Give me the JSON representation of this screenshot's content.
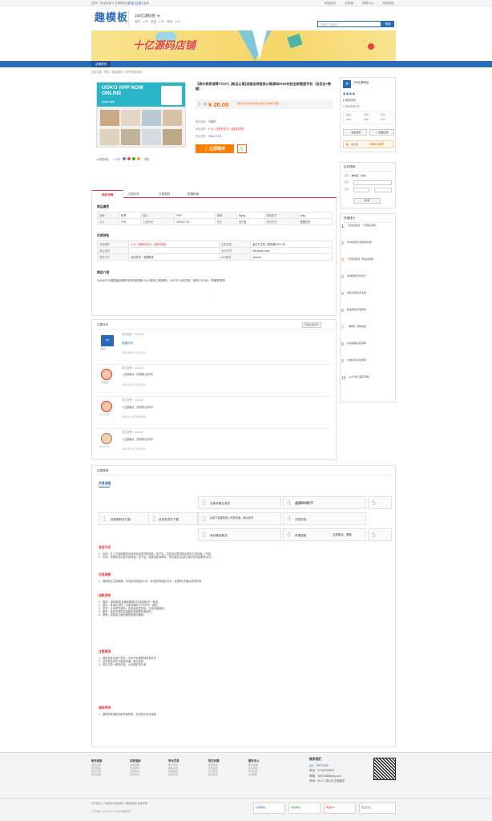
{
  "topbar": {
    "left": [
      "您好！欢迎来到十亿源码网",
      "[登录]",
      "[注册]",
      "免费"
    ],
    "right": [
      "网站首页",
      "手机版",
      "帮助中心",
      "网站导航"
    ]
  },
  "header": {
    "logo": "趣模板",
    "shop_name": "100亿源码店",
    "shop_stats": "描述：4.99　质量：4.99　服务：5.00",
    "search_placeholder": "请输入关键词",
    "search_button": "搜索"
  },
  "banner": {
    "title": "十亿源码店铺"
  },
  "nav": {
    "items": [
      "店铺首页"
    ]
  },
  "breadcrumb": "当前位置：首页 > 网站源码 > 房产/新闻/商务",
  "product": {
    "image_title": "UOKO APP NOW ONLINE",
    "image_sub": "UOKO APP",
    "title": "【高价卖家保障YOU+】[新品公寓]深度去除租房公寓源码dede内核全新整版手机（含后台+数据）",
    "price_label": "价　格",
    "price": "¥ 20.00",
    "price_note": "需支付对应价格源码 前往平台购买页面",
    "fields": [
      {
        "label": "服务保障",
        "value": "不退货"
      },
      {
        "label": "卖家保障",
        "value": "¥ 15（可额外支付）【保障说明】"
      },
      {
        "label": "最后更新",
        "value": "2016-07-01"
      }
    ],
    "buy_button": "立即购买",
    "cart_icon": "cart-icon",
    "actions": [
      "收藏商品",
      "分享",
      "举报"
    ]
  },
  "tabs": [
    "商品详情",
    "交易评价",
    "交易规则",
    "防骗指南"
  ],
  "info": {
    "section1": "商品属性",
    "attrs": [
      [
        "品牌",
        "织梦",
        "语言",
        "PHP",
        "数据",
        "Mysql",
        "授权模式",
        "Wap"
      ],
      [
        "大小",
        "47M",
        "上线时间",
        "2016-07-01",
        "支付",
        "支付宝",
        "演示方式",
        "数据文件"
      ]
    ],
    "section2": "交易特色",
    "trade": [
      [
        "交易保障",
        "¥ 15（需额外支付）【保障说明】",
        "主机类型",
        "独立IP主机 / 服务器 VPS VM"
      ],
      [
        "售后说明",
        "",
        "运行环境",
        "Windows Linux"
      ],
      [
        "发货方式",
        "自动发货，需要联系",
        "web服务",
        "Apache"
      ]
    ],
    "section3": "商品介绍",
    "intro": "与#65279;蜗居租房源码手机版快捷YOU+精品公寓源码，DEDECMS内核，网站1.5G包，界面很漂亮"
  },
  "reviews": {
    "title": "交易评价",
    "button": "查看全部评价",
    "items": [
      {
        "user": "猫爷",
        "title": "成交金额：20.00元",
        "text": "谢谢评价",
        "date": "2016-08-03 17:41:34"
      },
      {
        "user": "苏哥哥",
        "title": "成交金额：20.00元",
        "text": "交易确认（系统默认好评）",
        "date": "2016-08-22 09:53:23"
      },
      {
        "user": "11*****22",
        "title": "成交金额：20.00元",
        "text": "交易确认（系统默认好评）",
        "date": "2016-02-26 09:43:08"
      },
      {
        "user": "fan****13",
        "title": "成交金额：20.00元",
        "text": "交易确认（系统默认好评）",
        "date": "2016-02-01 02:19:00"
      }
    ]
  },
  "rules": {
    "title": "交易规则",
    "flow_title": "交易流程",
    "steps": [
      "买家未确认收货",
      "超过24小时",
      "交易自动完成",
      "选择源码并付款",
      "自动发货并下载",
      "买家下载源码进入完成页面，确认收货",
      "交易完成",
      "有问题未解决",
      "申请退款",
      "交易取消，退款"
    ],
    "sections": [
      {
        "title": "发货方式",
        "lines": [
          "1．自动：在上方保障服务中标有自动发货的商品，拍下后，将会自动发送到买家的订单页面（下载）",
          "2．手动：未标有自动发货的商品，拍下后，卖家会收到邮件，也可通过QQ或订单中的电话联系对方。"
        ]
      },
      {
        "title": "交易周期",
        "lines": [
          "1．源码默认交易周期：自动发货商品为1天，手动发货商品为3天，买家有1天确认收货时间"
        ]
      },
      {
        "title": "退款说明",
        "lines": [
          "1．描述：源码描述(含基础数据)与实际源码不一致的；",
          "2．演示：有演示站时，与实际源码小于5%不一致的；",
          "3．发货：手动发货源码，在卖家未发货前，已申请退款的；",
          "4．服务：卖家不提供安装服务或需额外收费的；",
          "5．其他：如质量方面的硬性常规问题等。"
        ]
      },
      {
        "title": "注意事项",
        "lines": [
          "1．源码全部为用户发布，平台不对源码的质量负责",
          "2．请在购买前先与卖家沟通，确认商品",
          "3．双方达成一致的约定，以沟通记录为准"
        ]
      },
      {
        "title": "源码声明",
        "lines": [
          "1．源码所有版权归原作者所有，请勿用于商业用途"
        ]
      }
    ]
  },
  "sidebar": {
    "shop": {
      "name": "100亿源码店",
      "credit": "卖家信用",
      "qq": "2297181779",
      "ratings": [
        {
          "label": "描述",
          "value": "4.99"
        },
        {
          "label": "质量",
          "value": "4.99"
        },
        {
          "label": "服务",
          "value": "5.00"
        }
      ],
      "enter": "进店逛逛",
      "fav": "收藏店铺",
      "deposit_label": "保证金",
      "deposit": "1000.00元"
    },
    "search": {
      "title": "店内搜索",
      "kw_label": "搜索",
      "kw_options": [
        "本店",
        "关键"
      ],
      "price_label": "价格",
      "submit": "搜 索"
    },
    "rank": {
      "title": "热销排行",
      "items": [
        "【自动发货】一元网站源码",
        "2019最新影视源码系统",
        "【手机源码】带后台模板",
        "商城源码支持支付",
        "最新自适应企业站",
        "精品网站开发源码",
        "【推荐】源码模板",
        "在线客服系统源码",
        "文章资讯系统源码",
        "vue开发小程序源码"
      ]
    }
  },
  "footer": {
    "cols": [
      {
        "title": "新手指南",
        "items": [
          "如何注册",
          "如何购买",
          "如何付款",
          "常见问题"
        ]
      },
      {
        "title": "买家指南",
        "items": [
          "交易流程",
          "售后服务",
          "退款申请",
          "交易安全"
        ]
      },
      {
        "title": "安全交易",
        "items": [
          "账户安全",
          "诚信交易",
          "防骗指南",
          "担保交易"
        ]
      },
      {
        "title": "常见问题",
        "items": [
          "如何充值",
          "如何提现",
          "支付安全",
          "投诉建议"
        ]
      },
      {
        "title": "服务中心",
        "items": [
          "联系客服",
          "友情链接",
          "意见反馈",
          "QQ客服"
        ]
      }
    ],
    "contact": {
      "title": "联系我们",
      "qq": "QQ：18973458",
      "phone": "电话：17162729823",
      "email": "邮箱：18973458@qq.com",
      "hours": "时间：24 x 7 周六日正常服务"
    },
    "bottom": "关于我们 | 广告合作 | 联系我们 | 网站地图 | 免责声明",
    "copyright": "十亿源码 Copyright © 2016 版权所有",
    "badges": [
      "可信网站",
      "诚信网站",
      "网络110",
      "安全认证"
    ]
  }
}
